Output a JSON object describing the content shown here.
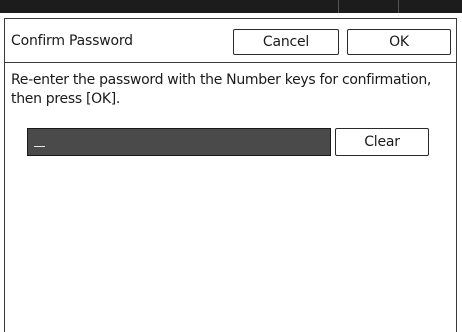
{
  "dialog": {
    "title": "Confirm Password",
    "cancel_label": "Cancel",
    "ok_label": "OK",
    "instruction_line1": "Re-enter the password with the Number keys for confirmation,",
    "instruction_line2": "then press [OK].",
    "password_value": "",
    "clear_label": "Clear"
  },
  "colors": {
    "bezel": "#1c1c1c",
    "field_background": "#4a4a4a",
    "border": "#3a3a3a"
  }
}
